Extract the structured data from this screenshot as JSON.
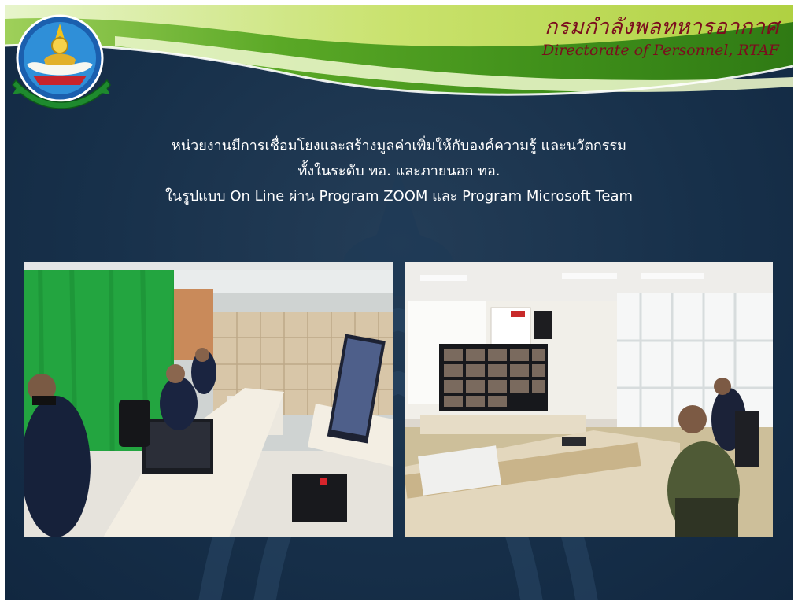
{
  "header": {
    "org_name_thai": "กรมกำลังพลทหารอากาศ",
    "org_name_en": "Directorate of Personnel, RTAF"
  },
  "headline": {
    "line1": "หน่วยงานมีการเชื่อมโยงและสร้างมูลค่าเพิ่มให้กับองค์ความรู้ และนวัตกรรม",
    "line2": "ทั้งในระดับ ทอ. และภายนอก ทอ.",
    "line3": "ในรูปแบบ On Line ผ่าน Program ZOOM และ Program Microsoft Team"
  },
  "colors": {
    "background": "#17304a",
    "banner_green": "#4f9a1a",
    "banner_light": "#d7e84a",
    "title_red": "#7b0d1e",
    "text": "#ffffff"
  },
  "icons": {
    "emblem": "rtaf-personnel-emblem-icon"
  },
  "photos": [
    {
      "name": "video-conference-room-green-screen"
    },
    {
      "name": "video-conference-meeting-room-zoom"
    }
  ]
}
